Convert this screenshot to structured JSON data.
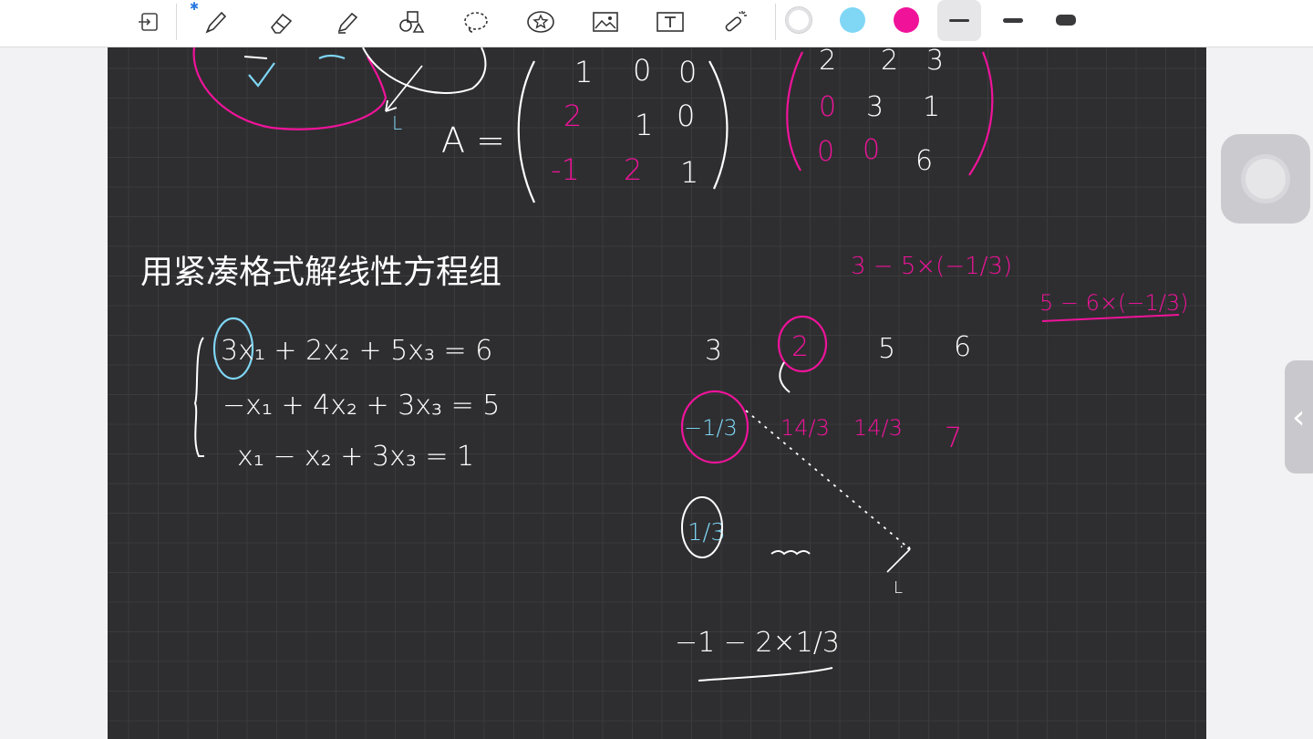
{
  "toolbar": {
    "tools": [
      "lasso-page-icon",
      "pen-icon",
      "eraser-icon",
      "highlighter-icon",
      "shapes-icon",
      "lasso-icon",
      "sticker-icon",
      "image-icon",
      "text-tool-icon",
      "laser-pointer-icon"
    ],
    "colors": {
      "white": "#ffffff",
      "cyan": "#7fd6f5",
      "magenta": "#f0139a"
    },
    "selected_stroke": "thin"
  },
  "notes": {
    "heading": "用紧凑格式解线性方程组",
    "matrix_label": "A =",
    "matrix_L": [
      [
        "1",
        "0",
        "0"
      ],
      [
        "2",
        "1",
        "0"
      ],
      [
        "-1",
        "2",
        "1"
      ]
    ],
    "matrix_U": [
      [
        "2",
        "2",
        "3"
      ],
      [
        "0",
        "3",
        "1"
      ],
      [
        "0",
        "0",
        "6"
      ]
    ],
    "system": [
      "3x₁ + 2x₂ + 5x₃ = 6",
      "−x₁ + 4x₂ + 3x₃ = 5",
      "x₁ − x₂ + 3x₃ = 1"
    ],
    "row_values": [
      "3",
      "2",
      "5",
      "6"
    ],
    "second_row": [
      "−1/3",
      "14/3",
      "14/3",
      "7"
    ],
    "annotation_1": "3 − 5×(−1/3)",
    "annotation_2": "5 − 6×(−1/3)",
    "third_row_first": "1/3",
    "bottom_expression": "−1 − 2×1/3",
    "l_labels": [
      "L",
      "L"
    ]
  }
}
